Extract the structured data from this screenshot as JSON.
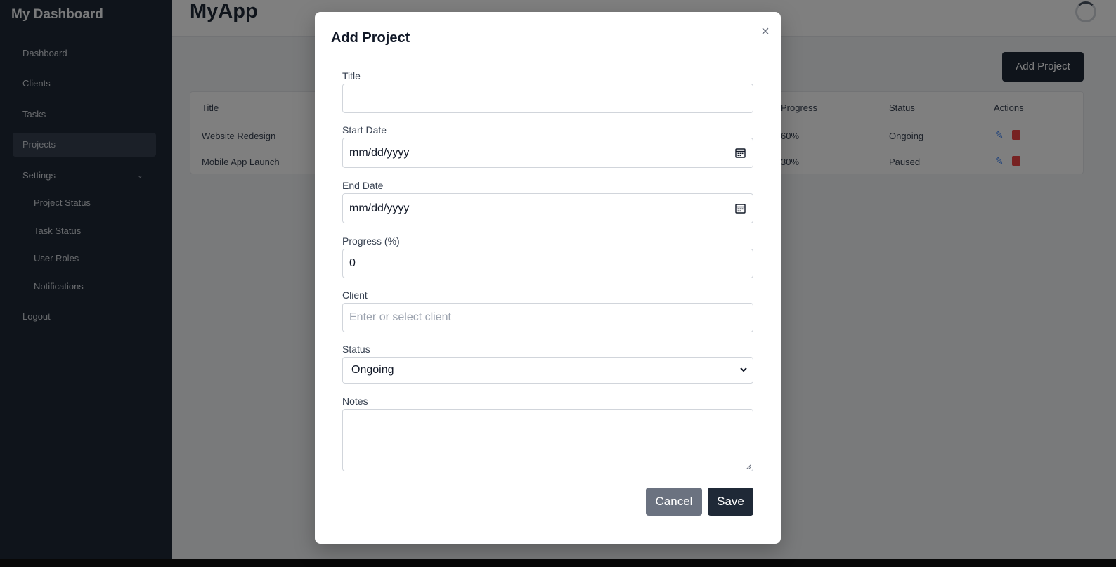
{
  "sidebar": {
    "brand": "My Dashboard",
    "items": [
      {
        "label": "Dashboard"
      },
      {
        "label": "Clients"
      },
      {
        "label": "Tasks"
      },
      {
        "label": "Projects"
      },
      {
        "label": "Settings"
      },
      {
        "label": "Project Status"
      },
      {
        "label": "Task Status"
      },
      {
        "label": "User Roles"
      },
      {
        "label": "Notifications"
      },
      {
        "label": "Logout"
      }
    ]
  },
  "header": {
    "app_title": "MyApp",
    "add_project_label": "Add Project"
  },
  "table": {
    "columns": [
      "Title",
      "Progress",
      "Status",
      "Actions"
    ],
    "rows": [
      {
        "title": "Website Redesign",
        "progress": "60%",
        "status": "Ongoing"
      },
      {
        "title": "Mobile App Launch",
        "progress": "30%",
        "status": "Paused"
      }
    ]
  },
  "modal": {
    "title": "Add Project",
    "close_symbol": "×",
    "fields": {
      "title": {
        "label": "Title",
        "value": ""
      },
      "start_date": {
        "label": "Start Date",
        "placeholder": "mm/dd/yyyy"
      },
      "end_date": {
        "label": "End Date",
        "placeholder": "mm/dd/yyyy"
      },
      "progress": {
        "label": "Progress (%)",
        "value": "0"
      },
      "client": {
        "label": "Client",
        "placeholder": "Enter or select client"
      },
      "status": {
        "label": "Status",
        "value": "Ongoing"
      },
      "notes": {
        "label": "Notes",
        "value": ""
      }
    },
    "cancel_label": "Cancel",
    "save_label": "Save"
  },
  "colors": {
    "sidebar_bg": "#1f2937",
    "primary_button": "#1f2937",
    "cancel_button": "#6b7280",
    "edit_icon": "#3b82f6",
    "delete_icon": "#ef4444"
  }
}
